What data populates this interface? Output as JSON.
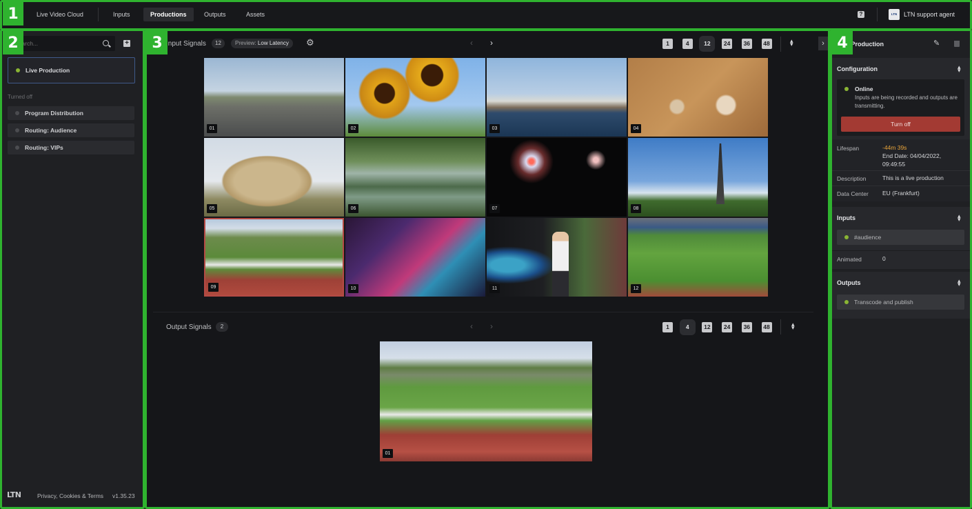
{
  "topbar": {
    "brand": "Live Video Cloud",
    "nav": [
      "Inputs",
      "Productions",
      "Outputs",
      "Assets"
    ],
    "active_nav": "Productions",
    "help_icon": "help-icon",
    "logo_mark": "LTN",
    "user_label": "LTN support agent"
  },
  "markers": [
    "1",
    "2",
    "3",
    "4"
  ],
  "sidebar": {
    "search_placeholder": "Search...",
    "active_item": "Live Production",
    "group_label": "Turned off",
    "items": [
      "Program Distribution",
      "Routing: Audience",
      "Routing: VIPs"
    ],
    "footer_logo": "LTN",
    "footer_links": "Privacy, Cookies & Terms",
    "version": "v1.35.23"
  },
  "inputs": {
    "title": "Input Signals",
    "count": "12",
    "preview_label": "Preview:",
    "preview_value": "Low Latency",
    "grid_options": [
      "1",
      "4",
      "12",
      "24",
      "36",
      "48"
    ],
    "selected_grid": "12",
    "tiles": [
      "01",
      "02",
      "03",
      "04",
      "05",
      "06",
      "07",
      "08",
      "09",
      "10",
      "11",
      "12"
    ]
  },
  "outputs": {
    "title": "Output Signals",
    "count": "2",
    "grid_options": [
      "1",
      "4",
      "12",
      "24",
      "36",
      "48"
    ],
    "selected_grid": "4",
    "tiles": [
      "01"
    ]
  },
  "detail": {
    "title": "Live Production",
    "configuration": {
      "header": "Configuration",
      "status": "Online",
      "status_desc": "Inputs are being recorded and outputs are transmitting.",
      "turn_off": "Turn off",
      "lifespan_label": "Lifespan",
      "lifespan_value": "-44m 39s",
      "end_date": "End Date: 04/04/2022,",
      "end_time": "09:49:55",
      "description_label": "Description",
      "description_value": "This is a live production",
      "dc_label": "Data Center",
      "dc_value": "EU (Frankfurt)"
    },
    "inputs_section": {
      "header": "Inputs",
      "item": "#audience",
      "animated_label": "Animated",
      "animated_value": "0"
    },
    "outputs_section": {
      "header": "Outputs",
      "item": "Transcode and publish"
    }
  },
  "colors": {
    "accent_green": "#2fb32f",
    "status_green": "#8ab534",
    "danger": "#a33a33",
    "warning": "#e8a43a"
  }
}
